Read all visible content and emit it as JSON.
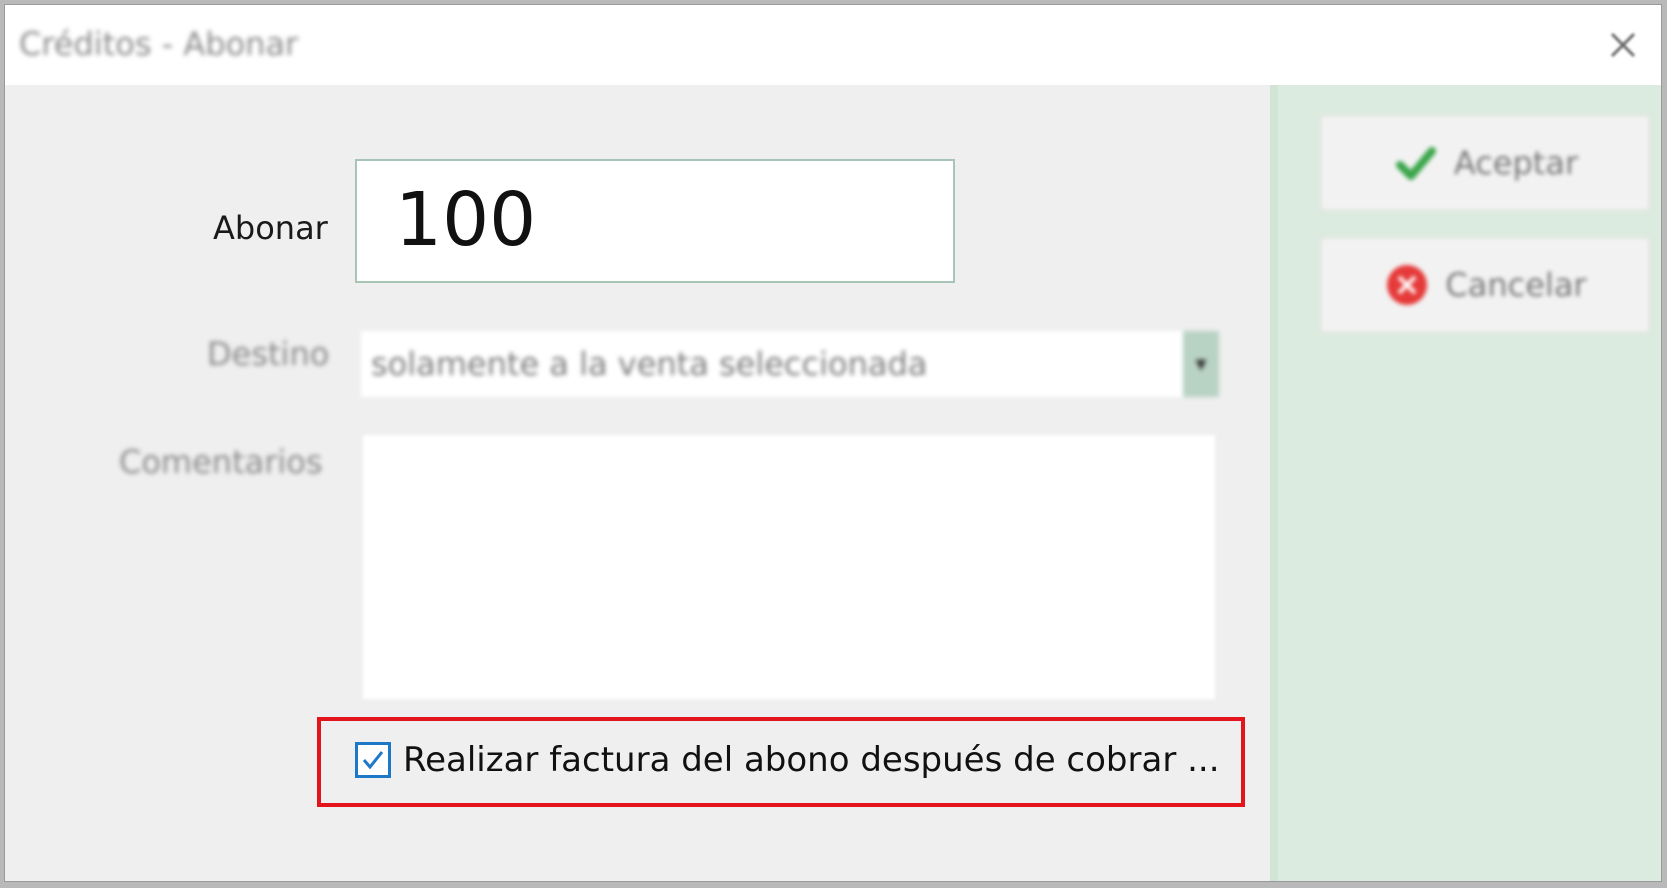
{
  "window": {
    "title": "Créditos - Abonar"
  },
  "form": {
    "abonar_label": "Abonar",
    "abonar_value": "100",
    "destino_label": "Destino",
    "destino_value": "solamente a la venta seleccionada",
    "comentarios_label": "Comentarios",
    "comentarios_value": "",
    "invoice_checkbox_label": "Realizar factura del abono después de cobrar ...",
    "invoice_checkbox_checked": true
  },
  "actions": {
    "accept_label": "Aceptar",
    "cancel_label": "Cancelar"
  },
  "colors": {
    "highlight": "#e3141c",
    "side_panel": "#dcebdf",
    "accept_icon": "#3aa64a",
    "cancel_icon": "#e63a3a",
    "checkbox_border": "#1e78c8"
  },
  "icons": {
    "close": "close-icon",
    "accept": "checkmark-icon",
    "cancel": "cancel-circle-icon",
    "dropdown": "chevron-down-icon",
    "checkbox": "checkbox-checked-icon"
  }
}
